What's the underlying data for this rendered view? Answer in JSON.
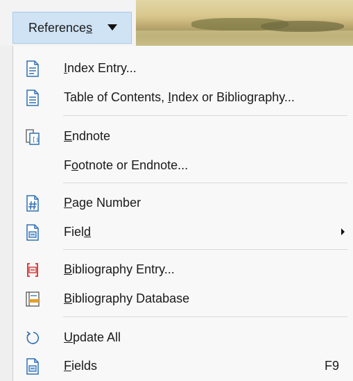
{
  "toolbar": {
    "references_button": {
      "label": "References",
      "icon": "caret-down-icon"
    }
  },
  "menu": {
    "items": [
      {
        "name": "index-entry",
        "label": "Index Entry...",
        "icon": "index-entry-icon"
      },
      {
        "name": "toc-index-bibliography",
        "label": "Table of Contents, Index or Bibliography...",
        "icon": "document-lines-icon"
      },
      {
        "name": "endnote",
        "label": "Endnote",
        "icon": "endnote-icon"
      },
      {
        "name": "footnote-or-endnote",
        "label": "Footnote or Endnote...",
        "icon": ""
      },
      {
        "name": "page-number",
        "label": "Page Number",
        "icon": "page-number-icon"
      },
      {
        "name": "field",
        "label": "Field",
        "icon": "field-icon",
        "submenu": true
      },
      {
        "name": "bibliography-entry",
        "label": "Bibliography Entry...",
        "icon": "bibliography-entry-icon"
      },
      {
        "name": "bibliography-database",
        "label": "Bibliography Database",
        "icon": "bibliography-database-icon"
      },
      {
        "name": "update-all",
        "label": "Update All",
        "icon": "update-icon"
      },
      {
        "name": "fields",
        "label": "Fields",
        "icon": "fields-icon",
        "shortcut": "F9"
      }
    ]
  },
  "colors": {
    "button_bg": "#cfe3f5",
    "menu_bg": "#f8f8f8",
    "icon_blue": "#2f6fb3",
    "icon_red": "#d0312d",
    "icon_orange": "#e5a02a"
  }
}
